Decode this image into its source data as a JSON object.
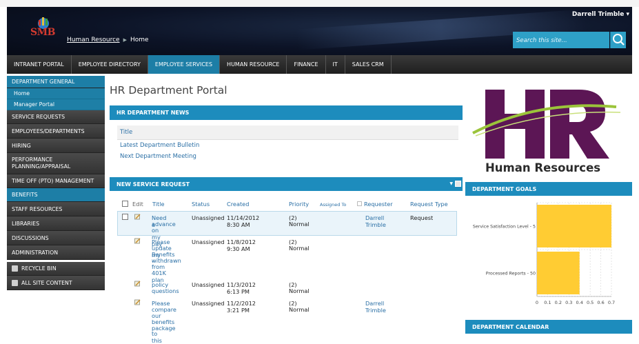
{
  "header": {
    "user": "Darrell Trimble",
    "logo_text": "SMB",
    "breadcrumb": [
      "Human Resource",
      "Home"
    ],
    "search_placeholder": "Search this site..."
  },
  "topnav": [
    "INTRANET PORTAL",
    "EMPLOYEE DIRECTORY",
    "EMPLOYEE SERVICES",
    "HUMAN RESOURCE",
    "FINANCE",
    "IT",
    "SALES CRM"
  ],
  "sidebar": {
    "items": [
      "DEPARTMENT GENERAL",
      "Home",
      "Manager Portal",
      "SERVICE REQUESTS",
      "EMPLOYEES/DEPARTMENTS",
      "HIRING",
      "PERFORMANCE PLANNING/APPRAISAL",
      "TIME OFF (PTO) MANAGEMENT",
      "BENEFITS",
      "STAFF RESOURCES",
      "LIBRARIES",
      "DISCUSSIONS",
      "ADMINISTRATION",
      "RECYCLE BIN",
      "ALL SITE CONTENT"
    ]
  },
  "page_title": "HR Department Portal",
  "news": {
    "heading": "HR DEPARTMENT NEWS",
    "column": "Title",
    "items": [
      "Latest Department Bulletin",
      "Next Department Meeting"
    ]
  },
  "requests": {
    "heading": "NEW SERVICE REQUEST",
    "columns": [
      "Edit",
      "Title",
      "Status",
      "Created",
      "Priority",
      "Assigned To",
      "Requester",
      "Request Type"
    ],
    "rows": [
      {
        "title": [
          "Need a",
          "advance",
          "on my pay"
        ],
        "status": "Unassigned",
        "created": "11/14/2012 8:30 AM",
        "priority": [
          "(2)",
          "Normal"
        ],
        "requester": "Darrell Trimble",
        "type": "Request"
      },
      {
        "title": [
          "Please",
          "update my",
          "Benefits --",
          "withdrawn",
          "from",
          "401K plan"
        ],
        "status": "Unassigned",
        "created": "11/8/2012 9:30 AM",
        "priority": [
          "(2)",
          "Normal"
        ],
        "requester": "",
        "type": ""
      },
      {
        "title": [
          "policy",
          "questions"
        ],
        "status": "Unassigned",
        "created": "11/3/2012 6:13 PM",
        "priority": [
          "(2)",
          "Normal"
        ],
        "requester": "",
        "type": ""
      },
      {
        "title": [
          "Please",
          "compare",
          "our",
          "benefits",
          "package",
          "to this"
        ],
        "status": "Unassigned",
        "created": "11/2/2012 3:21 PM",
        "priority": [
          "(2)",
          "Normal"
        ],
        "requester": "Darrell Trimble",
        "type": ""
      }
    ]
  },
  "hr_logo_text": "Human Resources",
  "goals": {
    "heading": "DEPARTMENT GOALS"
  },
  "calendar": {
    "heading": "DEPARTMENT CALENDAR"
  },
  "chart_data": {
    "type": "bar",
    "orientation": "horizontal",
    "categories": [
      "Service Satisfaction Level - 5",
      "Processed Reports - 50"
    ],
    "values": [
      0.7,
      0.4
    ],
    "xticks": [
      "0",
      "0.1",
      "0.2",
      "0.3",
      "0.4",
      "0.5",
      "0.6",
      "0.7"
    ],
    "xlim": [
      0,
      0.7
    ],
    "bar_color": "#ffcc33",
    "grid": "dashed"
  },
  "colors": {
    "accent": "#1d8cbd",
    "nav_active": "#1d7ea6",
    "link": "#2a6fa5"
  }
}
